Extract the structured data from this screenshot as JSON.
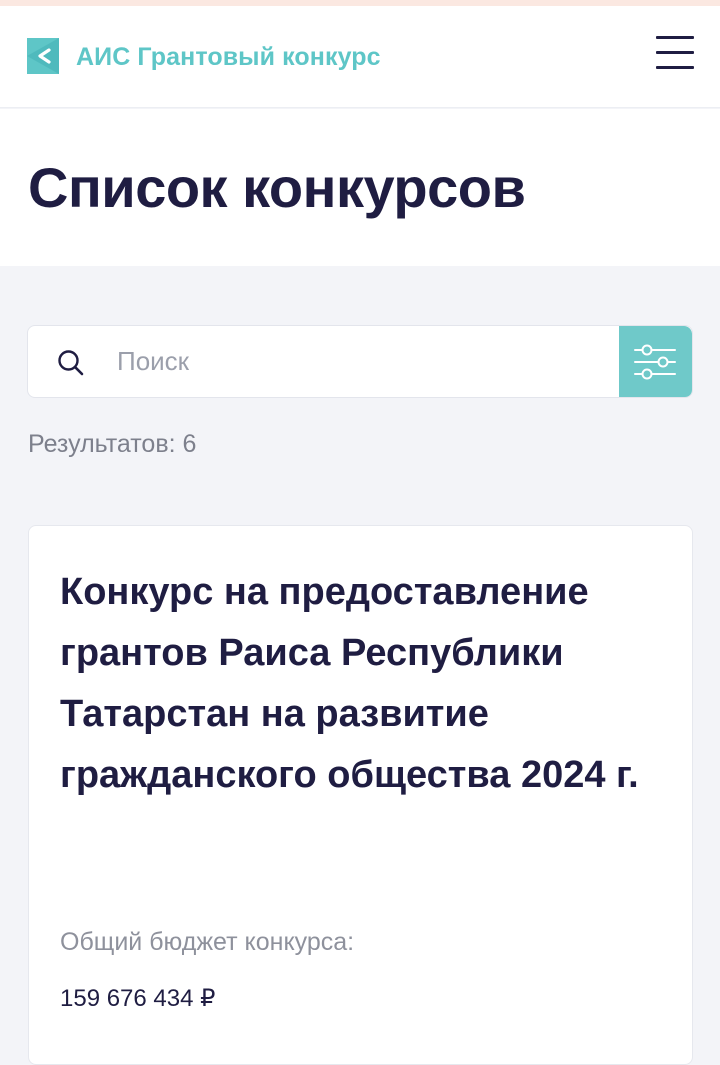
{
  "header": {
    "app_title": "АИС Грантовый конкурс",
    "logo_icon": "back-chevron-logo-icon",
    "menu_icon": "hamburger-menu-icon",
    "accent_color": "#5ec6c7"
  },
  "page": {
    "title": "Список конкурсов"
  },
  "search": {
    "placeholder": "Поиск",
    "value": "",
    "icon": "search-icon",
    "filter_icon": "sliders-filter-icon",
    "filter_color": "#6fc9c9"
  },
  "results": {
    "label": "Результатов: 6"
  },
  "cards": [
    {
      "title": "Конкурс на предоставление грантов Раиса Республики Татарстан на развитие гражданского общества 2024 г.",
      "budget_label": "Общий бюджет конкурса:",
      "budget_value": "159 676 434 ₽"
    }
  ]
}
